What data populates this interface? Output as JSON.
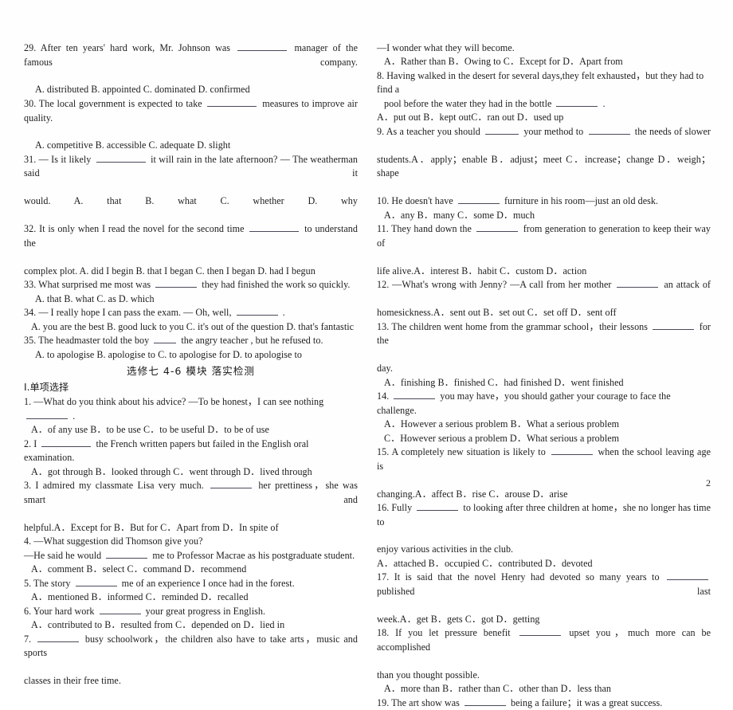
{
  "document": {
    "page_number": "2",
    "section_title_cn": "选修七 4-6 模块 落实检测",
    "section_heading_cn": "I.单项选择"
  },
  "left_column": {
    "lines": [
      {
        "id": "q29-stem",
        "text_before": "29. After ten years' hard work, Mr. Johnson was",
        "blank": "bl-l",
        "text_after": "manager of the famous company.",
        "justify": true,
        "indent": 0
      },
      {
        "id": "q29-options",
        "text": "A. distributed   B. appointed          C. dominated          D. confirmed",
        "justify": false,
        "indent": 14
      },
      {
        "id": "q30-stem",
        "text_before": "30. The local government is expected to take",
        "blank": "bl-l",
        "text_after": "measures to improve air quality.",
        "justify": true,
        "indent": 0
      },
      {
        "id": "q30-options",
        "text": "A. competitive B. accessible          C. adequate          D. slight",
        "justify": false,
        "indent": 14
      },
      {
        "id": "q31-stem",
        "text_before": "31. — Is it likely",
        "blank": "bl-l",
        "text_after": "it will rain in the late afternoon? — The weatherman said it",
        "justify": true,
        "indent": 0
      },
      {
        "id": "q31-options",
        "text": "would.                    A. that                    B. what                    C. whether                    D. why",
        "justify": true,
        "indent": 0
      },
      {
        "id": "q32-stem",
        "text_before": "32. It is only when I read the novel for the second time",
        "blank": "bl-l",
        "text_after": "to understand the",
        "justify": true,
        "indent": 0
      },
      {
        "id": "q32-options",
        "text": "complex plot.     A. did I begin B. that I began          C. then I began     D. had I begun",
        "justify": false,
        "indent": 0
      },
      {
        "id": "q33-stem",
        "text_before": "33. What surprised me most was",
        "blank": "bl-m",
        "text_after": "they had finished the work so quickly.",
        "justify": false,
        "indent": 0
      },
      {
        "id": "q33-options",
        "text": "A. that                    B. what                    C. as                              D. which",
        "justify": false,
        "indent": 14
      },
      {
        "id": "q34-stem",
        "text_before": "34. — I really hope I can pass the exam.        — Oh, well,",
        "blank": "bl-m",
        "text_after": ".",
        "justify": false,
        "indent": 0
      },
      {
        "id": "q34-options",
        "text": "A. you are the best   B. good luck to you   C. it's out of the question D. that's fantastic",
        "justify": false,
        "indent": 9
      },
      {
        "id": "q35-stem",
        "text_before": "35. The headmaster told the boy",
        "blank": "bl-xs",
        "text_after": "the angry teacher , but he refused to.",
        "justify": false,
        "indent": 0
      },
      {
        "id": "q35-options",
        "text": "A. to apologise     B. apologise to     C. to apologise for     D. to apologise to",
        "justify": false,
        "indent": 14
      },
      {
        "id": "q1-stem",
        "text_before": "1. —What do you think about his advice? —To be honest，I can see nothing",
        "blank": "bl-m",
        "text_after": ".",
        "justify": false,
        "indent": 0
      },
      {
        "id": "q1-options",
        "text": "A．of any use     B．to be use   C．to be useful   D．to be of use",
        "justify": false,
        "indent": 9
      },
      {
        "id": "q2-stem",
        "text_before": "2. I",
        "blank": "bl-l",
        "text_after": "the French written papers but failed in the English oral examination.",
        "justify": false,
        "indent": 0
      },
      {
        "id": "q2-options",
        "text": "A．got through   B．looked through C．went through D．lived through",
        "justify": false,
        "indent": 9
      },
      {
        "id": "q3-stem",
        "text_before": "3. I admired my classmate Lisa very much.",
        "blank": "bl-m",
        "text_after": "her prettiness，she was smart and",
        "justify": true,
        "indent": 0
      },
      {
        "id": "q3-options",
        "text": "helpful.A．Except for          B．But for   C．Apart from       D．In spite of",
        "justify": false,
        "indent": 0
      },
      {
        "id": "q4-stem",
        "text": "4. —What suggestion did Thomson give you?",
        "justify": false,
        "indent": 0
      },
      {
        "id": "q4-stem2",
        "text_before": "—He said he would",
        "blank": "bl-m",
        "text_after": "me to Professor Macrae as his postgraduate student.",
        "justify": false,
        "indent": 0
      },
      {
        "id": "q4-options",
        "text": "A．comment     B．select     C．command      D．recommend",
        "justify": false,
        "indent": 9
      },
      {
        "id": "q5-stem",
        "text_before": "5. The story",
        "blank": "bl-m",
        "text_after": "me of an experience I once had in the forest.",
        "justify": false,
        "indent": 0
      },
      {
        "id": "q5-options",
        "text": "A．mentioned   B．informed C．reminded       D．recalled",
        "justify": false,
        "indent": 9
      },
      {
        "id": "q6-stem",
        "text_before": "6. Your hard work",
        "blank": "bl-m",
        "text_after": "your great progress in English.",
        "justify": false,
        "indent": 0
      },
      {
        "id": "q6-options",
        "text": "A．contributed to   B．resulted from   C．depended on   D．lied in",
        "justify": false,
        "indent": 9
      },
      {
        "id": "q7-stem",
        "text_before": "7.",
        "blank": "bl-m",
        "text_after": "busy schoolwork，the children also have to take arts，music and sports",
        "justify": true,
        "indent": 0
      },
      {
        "id": "q7-stem2",
        "text": "classes in their free time.",
        "justify": false,
        "indent": 0
      }
    ]
  },
  "right_column": {
    "lines": [
      {
        "id": "q7-cont",
        "text": "—I wonder what they will become.",
        "justify": false,
        "indent": 0
      },
      {
        "id": "q7-options",
        "text": "A．Rather than          B．Owing to  C．Except for          D．Apart from",
        "justify": false,
        "indent": 9
      },
      {
        "id": "q8-stem",
        "text": "8. Having walked in the desert for several days,they felt exhausted，but they had to find a",
        "justify": false,
        "indent": 0
      },
      {
        "id": "q8-stem2",
        "text_before": "pool before the water they had in the bottle",
        "blank": "bl-m",
        "text_after": ".",
        "justify": false,
        "indent": 9
      },
      {
        "id": "q8-options",
        "text": "A．put out   B．kept outC．ran out   D．used up",
        "justify": false,
        "indent": 0
      },
      {
        "id": "q9-stem",
        "text_before": "9. As a teacher you should",
        "blank": "bl-s",
        "text_after_blank2": "your method to",
        "blank2": "bl-m",
        "text_after": "the needs of slower",
        "justify": true,
        "indent": 0
      },
      {
        "id": "q9-options",
        "text": "students.A．apply；enable   B．adjust；meet   C．increase；change   D．weigh；shape",
        "justify": true,
        "indent": 0
      },
      {
        "id": "q10-stem",
        "text_before": "10. He doesn't have",
        "blank": "bl-m",
        "text_after": "furniture in his room—just an old desk.",
        "justify": false,
        "indent": 0
      },
      {
        "id": "q10-options",
        "text": "A．any       B．many   C．some   D．much",
        "justify": false,
        "indent": 9
      },
      {
        "id": "q11-stem",
        "text_before": "11. They hand down the",
        "blank": "bl-m",
        "text_after": "from generation to generation to keep their way of",
        "justify": true,
        "indent": 0
      },
      {
        "id": "q11-options",
        "text": "life alive.A．interest   B．habit C．custom     D．action",
        "justify": false,
        "indent": 0
      },
      {
        "id": "q12-stem",
        "text_before": "12. —What's wrong with Jenny? —A call from her mother",
        "blank": "bl-m",
        "text_after": "an attack of",
        "justify": true,
        "indent": 0
      },
      {
        "id": "q12-options",
        "text": "homesickness.A．sent out          B．set out     C．set off     D．sent off",
        "justify": false,
        "indent": 0
      },
      {
        "id": "q13-stem",
        "text_before": "13. The children went home from the grammar school，their lessons",
        "blank": "bl-m",
        "text_after": "for the",
        "justify": true,
        "indent": 0
      },
      {
        "id": "q13-stem2",
        "text": "day.",
        "justify": false,
        "indent": 0
      },
      {
        "id": "q13-options",
        "text": "A．finishing   B．finished C．had finished   D．went finished",
        "justify": false,
        "indent": 9
      },
      {
        "id": "q14-stem",
        "text_before": "14.",
        "blank": "bl-m",
        "text_after": "you may have，you should gather your courage to face the challenge.",
        "justify": false,
        "indent": 0
      },
      {
        "id": "q14-options-ab",
        "text": "A．However a serious problem B．What a serious problem",
        "justify": false,
        "indent": 9
      },
      {
        "id": "q14-options-cd",
        "text": "C．However serious a problem D．What serious a problem",
        "justify": false,
        "indent": 9
      },
      {
        "id": "q15-stem",
        "text_before": "15. A completely new situation is likely to",
        "blank": "bl-m",
        "text_after": "when the school leaving age is",
        "justify": true,
        "indent": 0
      },
      {
        "id": "q15-options",
        "text": "changing.A．affect          B．rise  C．arouse          D．arise",
        "justify": false,
        "indent": 0
      },
      {
        "id": "q16-stem",
        "text_before": "16. Fully",
        "blank": "bl-m",
        "text_after": "to looking after three children at home，she no longer has time to",
        "justify": true,
        "indent": 0
      },
      {
        "id": "q16-stem2",
        "text": "enjoy various activities in the club.",
        "justify": false,
        "indent": 0
      },
      {
        "id": "q16-options",
        "text": "A．attached   B．occupied   C．contributed      D．devoted",
        "justify": false,
        "indent": 0
      },
      {
        "id": "q17-stem",
        "text_before": "17. It is said that the novel Henry had devoted so many years to",
        "blank": "bl-m",
        "text_after": "published last",
        "justify": true,
        "indent": 0
      },
      {
        "id": "q17-options",
        "text": "week.A．get       B．gets    C．got          D．getting",
        "justify": false,
        "indent": 0
      },
      {
        "id": "q18-stem",
        "text_before": "18. If you let pressure benefit",
        "blank": "bl-m",
        "text_after": "upset you，much more can be accomplished",
        "justify": true,
        "indent": 0
      },
      {
        "id": "q18-stem2",
        "text": "than you thought possible.",
        "justify": false,
        "indent": 0
      },
      {
        "id": "q18-options",
        "text": "A．more than      B．rather than   C．other than       D．less than",
        "justify": false,
        "indent": 9
      },
      {
        "id": "q19-stem",
        "text_before": "19. The art show was",
        "blank": "bl-m",
        "text_after": "being a failure；it was a great success.",
        "justify": false,
        "indent": 0
      }
    ]
  }
}
